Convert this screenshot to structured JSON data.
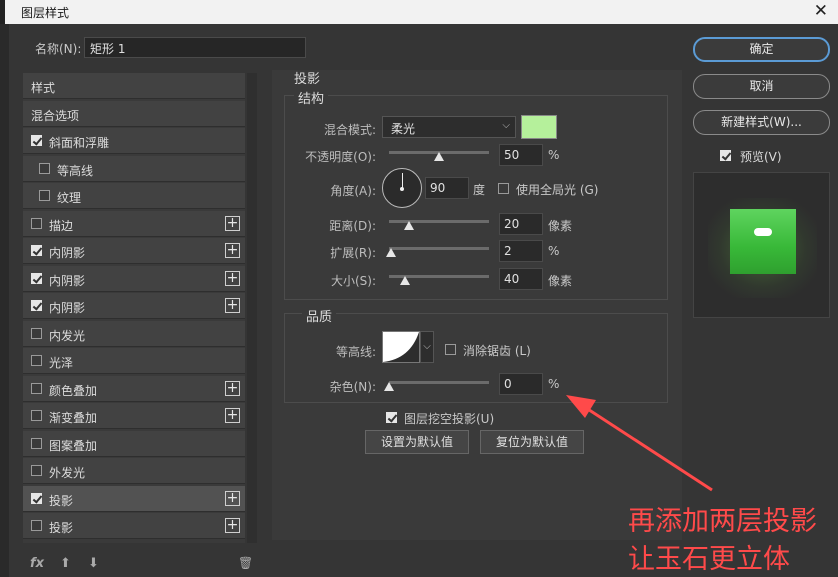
{
  "window": {
    "title": "图层样式",
    "close": "✕"
  },
  "name": {
    "label": "名称(N):",
    "value": "矩形 1"
  },
  "styles": {
    "items": [
      {
        "label": "样式",
        "checkbox": false,
        "checked": false,
        "plus": false,
        "indent": 0
      },
      {
        "label": "混合选项",
        "checkbox": false,
        "checked": false,
        "plus": false,
        "indent": 0
      },
      {
        "label": "斜面和浮雕",
        "checkbox": true,
        "checked": true,
        "plus": false,
        "indent": 0
      },
      {
        "label": "等高线",
        "checkbox": true,
        "checked": false,
        "plus": false,
        "indent": 1
      },
      {
        "label": "纹理",
        "checkbox": true,
        "checked": false,
        "plus": false,
        "indent": 1
      },
      {
        "label": "描边",
        "checkbox": true,
        "checked": false,
        "plus": true,
        "indent": 0
      },
      {
        "label": "内阴影",
        "checkbox": true,
        "checked": true,
        "plus": true,
        "indent": 0
      },
      {
        "label": "内阴影",
        "checkbox": true,
        "checked": true,
        "plus": true,
        "indent": 0
      },
      {
        "label": "内阴影",
        "checkbox": true,
        "checked": true,
        "plus": true,
        "indent": 0
      },
      {
        "label": "内发光",
        "checkbox": true,
        "checked": false,
        "plus": false,
        "indent": 0
      },
      {
        "label": "光泽",
        "checkbox": true,
        "checked": false,
        "plus": false,
        "indent": 0
      },
      {
        "label": "颜色叠加",
        "checkbox": true,
        "checked": false,
        "plus": true,
        "indent": 0
      },
      {
        "label": "渐变叠加",
        "checkbox": true,
        "checked": false,
        "plus": true,
        "indent": 0
      },
      {
        "label": "图案叠加",
        "checkbox": true,
        "checked": false,
        "plus": false,
        "indent": 0
      },
      {
        "label": "外发光",
        "checkbox": true,
        "checked": false,
        "plus": false,
        "indent": 0
      },
      {
        "label": "投影",
        "checkbox": true,
        "checked": true,
        "plus": true,
        "indent": 0,
        "active": true
      },
      {
        "label": "投影",
        "checkbox": true,
        "checked": false,
        "plus": true,
        "indent": 0
      }
    ],
    "fx_label": "fx",
    "up_icon": "⬆",
    "down_icon": "⬇",
    "trash_icon": "🗑"
  },
  "shadow": {
    "section_title": "投影",
    "structure_title": "结构",
    "blend_mode_label": "混合模式:",
    "blend_mode_value": "柔光",
    "blend_color": "#b5f09b",
    "opacity_label": "不透明度(O):",
    "opacity_value": "50",
    "opacity_unit": "%",
    "opacity_level": 0.5,
    "angle_label": "角度(A):",
    "angle_value": "90",
    "angle_unit": "度",
    "global_light_label": "使用全局光 (G)",
    "global_light_checked": false,
    "distance_label": "距离(D):",
    "distance_value": "20",
    "distance_unit": "像素",
    "distance_level": 0.2,
    "spread_label": "扩展(R):",
    "spread_value": "2",
    "spread_unit": "%",
    "spread_level": 0.02,
    "size_label": "大小(S):",
    "size_value": "40",
    "size_unit": "像素",
    "size_level": 0.16,
    "quality_title": "品质",
    "contour_label": "等高线:",
    "antialias_label": "消除锯齿 (L)",
    "antialias_checked": false,
    "noise_label": "杂色(N):",
    "noise_value": "0",
    "noise_unit": "%",
    "noise_level": 0,
    "knockout_label": "图层挖空投影(U)",
    "knockout_checked": true,
    "set_default_label": "设置为默认值",
    "reset_default_label": "复位为默认值"
  },
  "buttons": {
    "ok": "确定",
    "cancel": "取消",
    "new_style": "新建样式(W)...",
    "preview_label": "预览(V)",
    "preview_checked": true
  },
  "annotation": {
    "line1": "再添加两层投影",
    "line2": "让玉石更立体",
    "color": "#ff4a4a"
  }
}
